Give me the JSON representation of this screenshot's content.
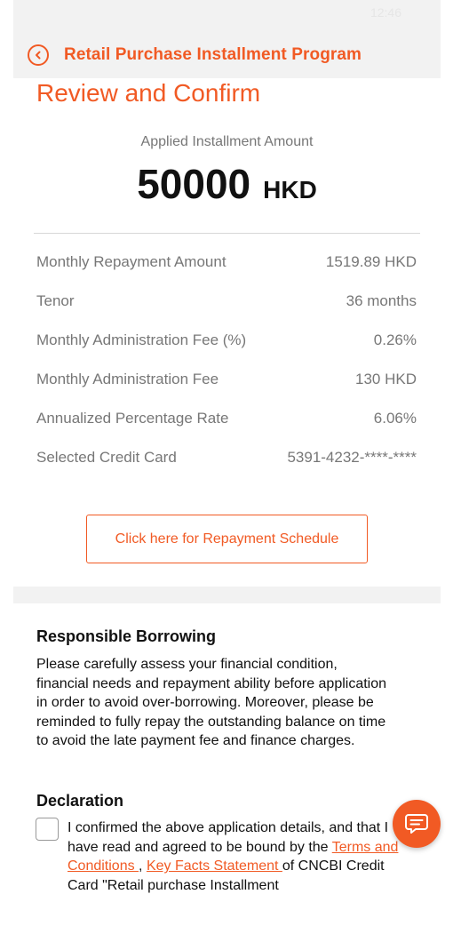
{
  "status": {
    "time": "12:46"
  },
  "header": {
    "title": "Retail Purchase Installment Program"
  },
  "page_title": "Review and Confirm",
  "amount": {
    "label": "Applied Installment Amount",
    "value": "50000",
    "currency": "HKD"
  },
  "details": [
    {
      "label": "Monthly Repayment Amount",
      "value": "1519.89 HKD"
    },
    {
      "label": "Tenor",
      "value": "36 months"
    },
    {
      "label": "Monthly Administration Fee (%)",
      "value": "0.26%"
    },
    {
      "label": "Monthly Administration Fee",
      "value": "130 HKD"
    },
    {
      "label": "Annualized Percentage Rate",
      "value": "6.06%"
    },
    {
      "label": "Selected Credit Card",
      "value": "5391-4232-****-****"
    }
  ],
  "schedule_button": "Click here for Repayment Schedule",
  "responsible_borrowing": {
    "title": "Responsible Borrowing",
    "body": "Please carefully assess your financial condition, financial needs and repayment ability before application in order to avoid over-borrowing. Moreover, please be reminded to fully repay the outstanding balance on time to avoid the late payment fee and finance charges."
  },
  "declaration": {
    "title": "Declaration",
    "text_before": "I confirmed the above application details, and that I have read and agreed to be bound by the ",
    "link_terms": "Terms and Conditions ",
    "separator": ", ",
    "link_kfs": "Key Facts Statement ",
    "text_after": "of CNCBI Credit Card \"Retail purchase Installment"
  },
  "colors": {
    "accent": "#f15a24",
    "band": "#f2f2f2",
    "muted_text": "#777777"
  },
  "icons": {
    "back": "back-arrow-circle-icon",
    "chat": "chat-bubble-icon"
  }
}
